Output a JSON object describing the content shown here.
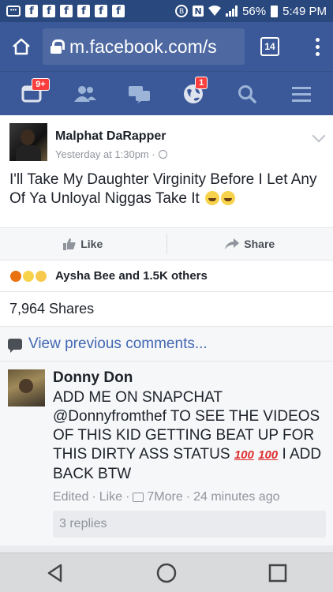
{
  "status_bar": {
    "battery": "56%",
    "time": "5:49 PM",
    "fb_icon_glyph": "f",
    "bt_glyph": "B",
    "nfc_glyph": "N"
  },
  "browser": {
    "url": "m.facebook.com/s",
    "tab_count": "14"
  },
  "nav": {
    "friend_requests_badge": "9+",
    "notifications_badge": "1"
  },
  "post": {
    "author": "Malphat DaRapper",
    "timestamp": "Yesterday at 1:30pm · ",
    "text": "I'll Take My Daughter Virginity Before I Let Any Of Ya Unloyal Niggas Take It",
    "actions": {
      "like": "Like",
      "share": "Share"
    },
    "reactions_text": "Aysha Bee and 1.5K others",
    "shares": "7,964 Shares",
    "view_previous": "View previous comments..."
  },
  "comment": {
    "author": "Donny Don",
    "text_part1": "ADD ME ON SNAPCHAT @Donnyfromthef TO SEE THE VIDEOS OF THIS KID GETTING BEAT UP FOR THIS DIRTY ASS STATUS",
    "hundred_glyph": "100",
    "text_part2": "I ADD BACK BTW",
    "edited": "Edited",
    "like": "Like",
    "more": "7More",
    "time": "24 minutes ago",
    "replies": "3 replies"
  },
  "colors": {
    "fb_blue": "#3b5998",
    "status_blue": "#29487d",
    "link_blue": "#4267b2",
    "badge_red": "#fa3e3e"
  }
}
